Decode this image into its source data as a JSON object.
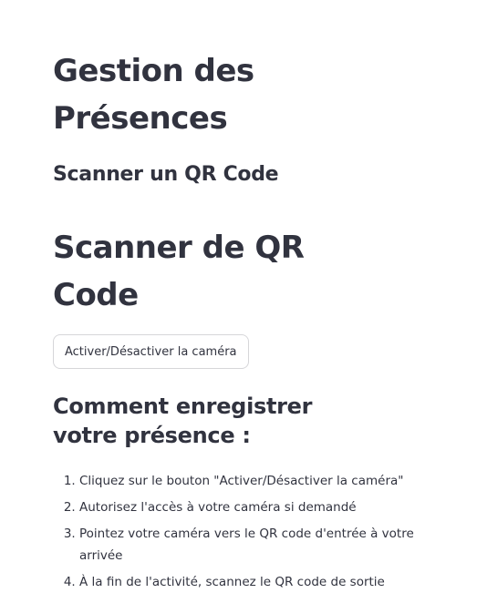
{
  "header": {
    "title": "Gestion des Présences",
    "subtitle": "Scanner un QR Code"
  },
  "scanner": {
    "title": "Scanner de QR Code",
    "camera_button_label": "Activer/Désactiver la caméra"
  },
  "instructions": {
    "title": "Comment enregistrer votre présence :",
    "steps": [
      "Cliquez sur le bouton \"Activer/Désactiver la caméra\"",
      "Autorisez l'accès à votre caméra si demandé",
      "Pointez votre caméra vers le QR code d'entrée à votre arrivée",
      "À la fin de l'activité, scannez le QR code de sortie"
    ]
  }
}
